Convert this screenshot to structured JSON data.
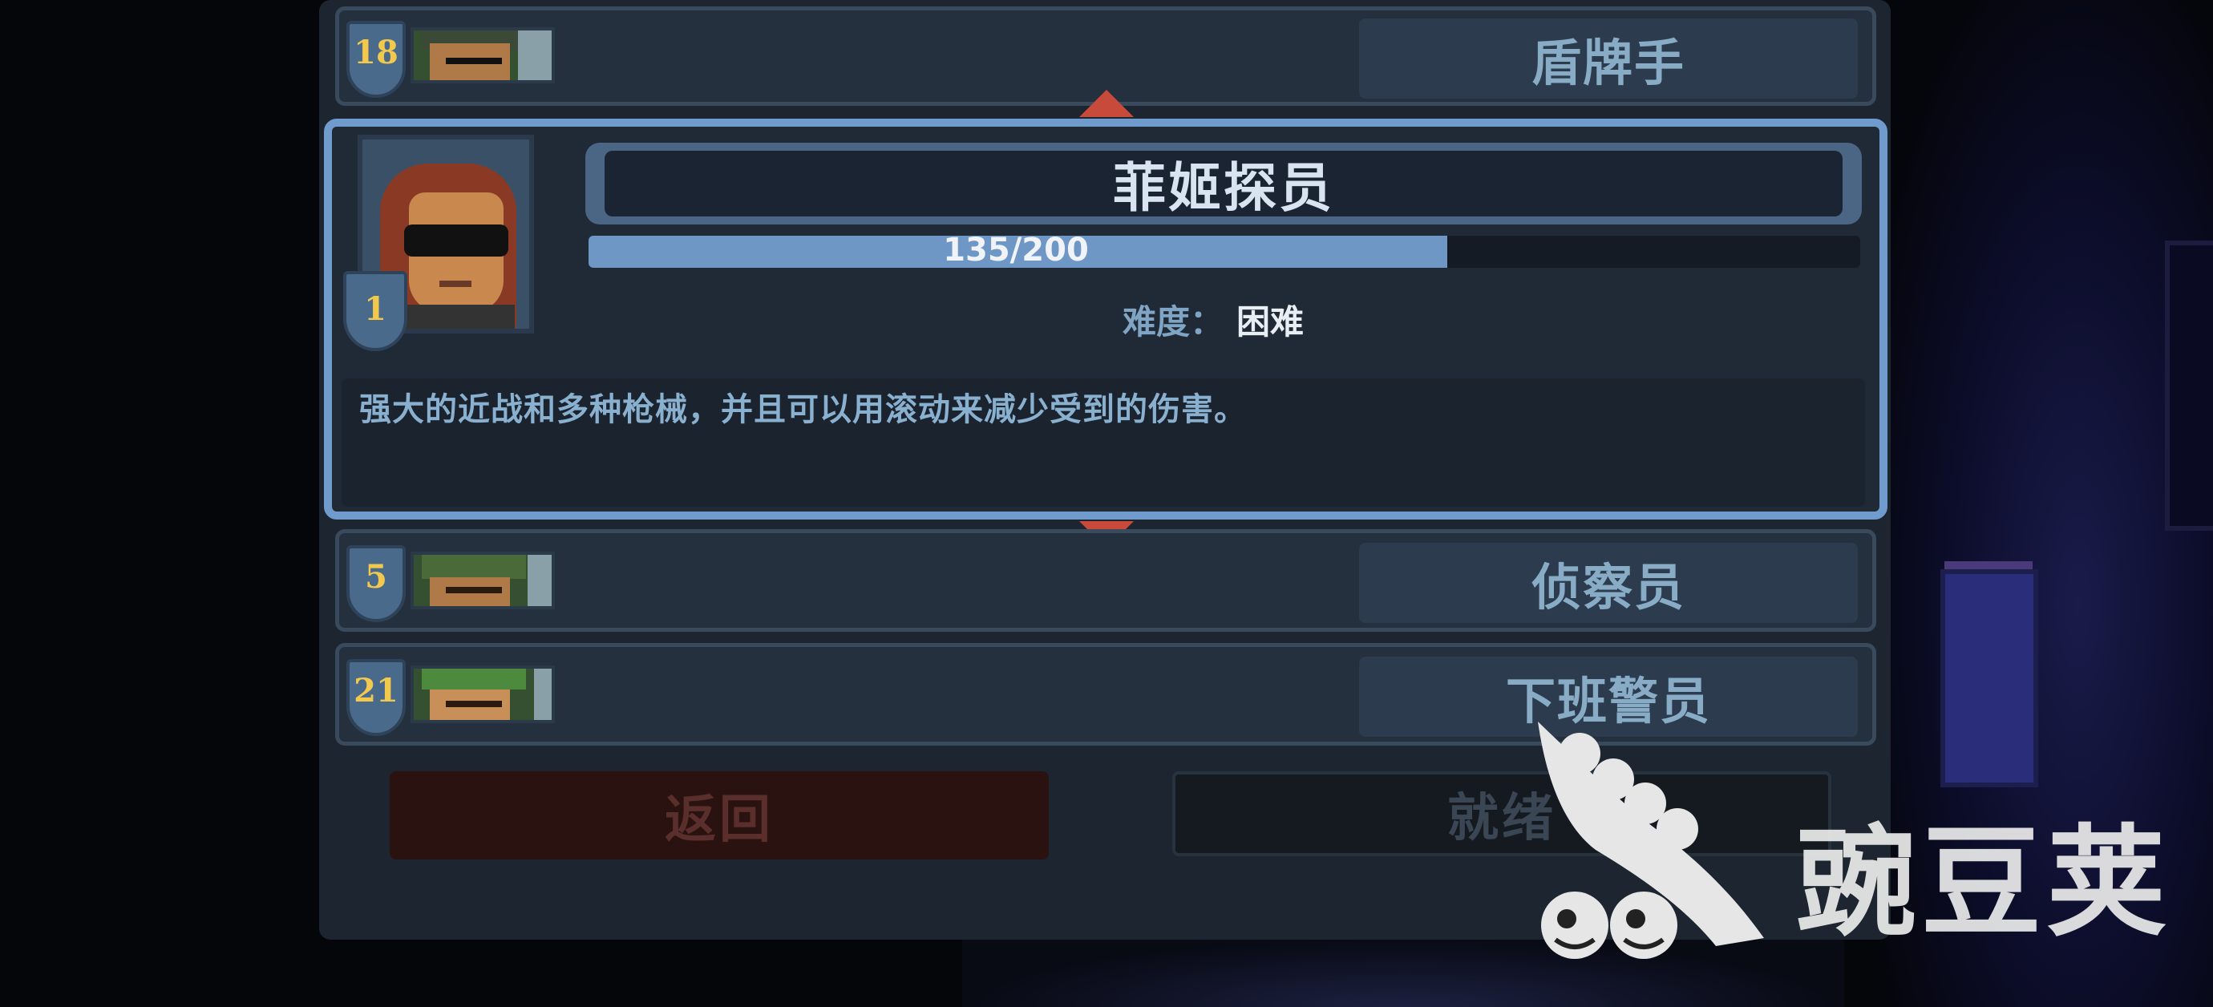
{
  "character_list": {
    "above": {
      "name": "盾牌手",
      "level": "18"
    },
    "selected": {
      "name": "菲姬探员",
      "level": "1",
      "xp_text": "135/200",
      "xp_fraction": 0.675,
      "difficulty_label": "难度：",
      "difficulty_value": "困难",
      "description": "强大的近战和多种枪械，并且可以用滚动来减少受到的伤害。"
    },
    "below": [
      {
        "name": "侦察员",
        "level": "5"
      },
      {
        "name": "下班警员",
        "level": "21"
      }
    ]
  },
  "buttons": {
    "back_label": "返回",
    "ready_label": "就绪"
  },
  "watermark": {
    "text": "豌豆荚"
  },
  "colors": {
    "panel": "#1c2530",
    "selected_border": "#6f9ccd",
    "level_number": "#f2c94c",
    "arrow": "#c84a3a",
    "name_text": "#88acc6"
  },
  "icons": [
    "scroll-up-arrow-icon",
    "scroll-down-arrow-icon",
    "level-shield-icon",
    "wandoujia-logo-icon"
  ]
}
